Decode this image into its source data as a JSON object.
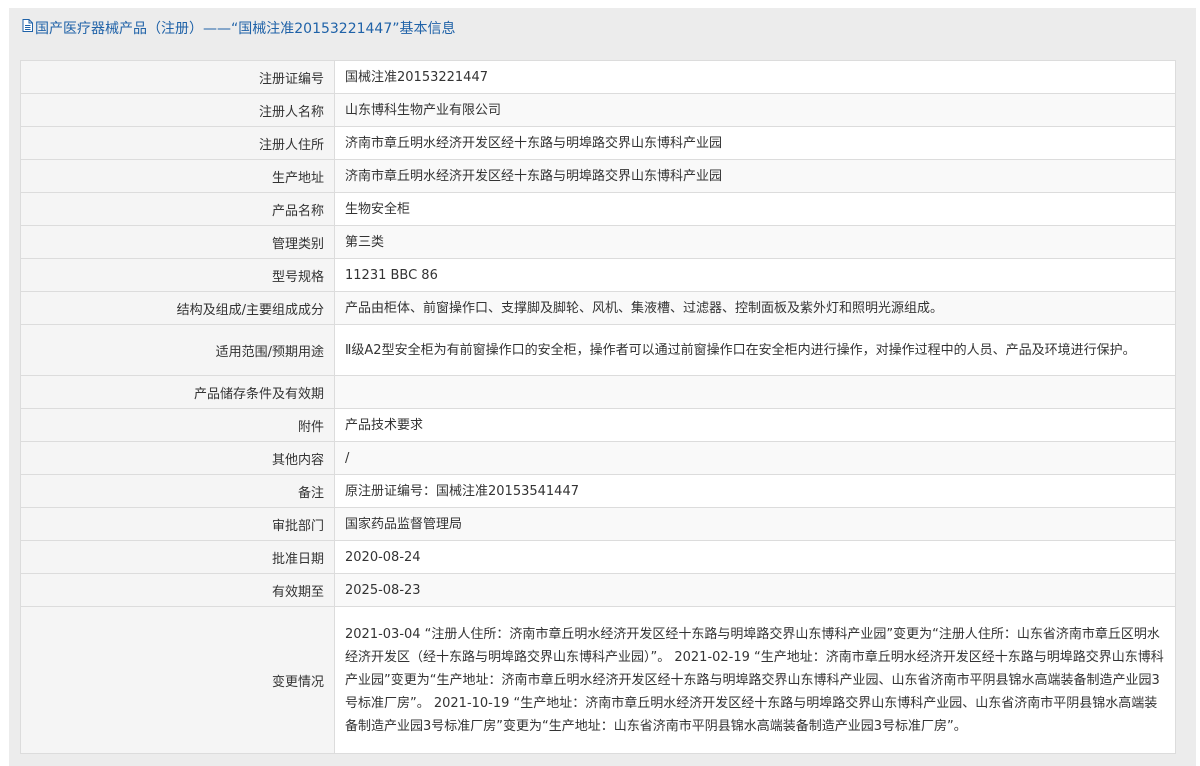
{
  "header": {
    "title": "国产医疗器械产品（注册）——“国械注准20153221447”基本信息"
  },
  "rows": [
    {
      "label": "注册证编号",
      "value": "国械注准20153221447"
    },
    {
      "label": "注册人名称",
      "value": "山东博科生物产业有限公司"
    },
    {
      "label": "注册人住所",
      "value": "济南市章丘明水经济开发区经十东路与明埠路交界山东博科产业园"
    },
    {
      "label": "生产地址",
      "value": "济南市章丘明水经济开发区经十东路与明埠路交界山东博科产业园"
    },
    {
      "label": "产品名称",
      "value": "生物安全柜"
    },
    {
      "label": "管理类别",
      "value": "第三类"
    },
    {
      "label": "型号规格",
      "value": "11231 BBC 86"
    },
    {
      "label": "结构及组成/主要组成成分",
      "value": "产品由柜体、前窗操作口、支撑脚及脚轮、风机、集液槽、过滤器、控制面板及紫外灯和照明光源组成。"
    },
    {
      "label": "适用范围/预期用途",
      "value": "Ⅱ级A2型安全柜为有前窗操作口的安全柜，操作者可以通过前窗操作口在安全柜内进行操作，对操作过程中的人员、产品及环境进行保护。"
    },
    {
      "label": "产品储存条件及有效期",
      "value": ""
    },
    {
      "label": "附件",
      "value": "产品技术要求"
    },
    {
      "label": "其他内容",
      "value": "/"
    },
    {
      "label": "备注",
      "value": "原注册证编号：国械注准20153541447"
    },
    {
      "label": "审批部门",
      "value": "国家药品监督管理局"
    },
    {
      "label": "批准日期",
      "value": "2020-08-24"
    },
    {
      "label": "有效期至",
      "value": "2025-08-23"
    },
    {
      "label": "变更情况",
      "value": "2021-03-04 “注册人住所：济南市章丘明水经济开发区经十东路与明埠路交界山东博科产业园”变更为“注册人住所：山东省济南市章丘区明水经济开发区（经十东路与明埠路交界山东博科产业园）”。 2021-02-19 “生产地址：济南市章丘明水经济开发区经十东路与明埠路交界山东博科产业园”变更为“生产地址：济南市章丘明水经济开发区经十东路与明埠路交界山东博科产业园、山东省济南市平阴县锦水高端装备制造产业园3号标准厂房”。 2021-10-19 “生产地址：济南市章丘明水经济开发区经十东路与明埠路交界山东博科产业园、山东省济南市平阴县锦水高端装备制造产业园3号标准厂房”变更为“生产地址：山东省济南市平阴县锦水高端装备制造产业园3号标准厂房”。"
    }
  ]
}
